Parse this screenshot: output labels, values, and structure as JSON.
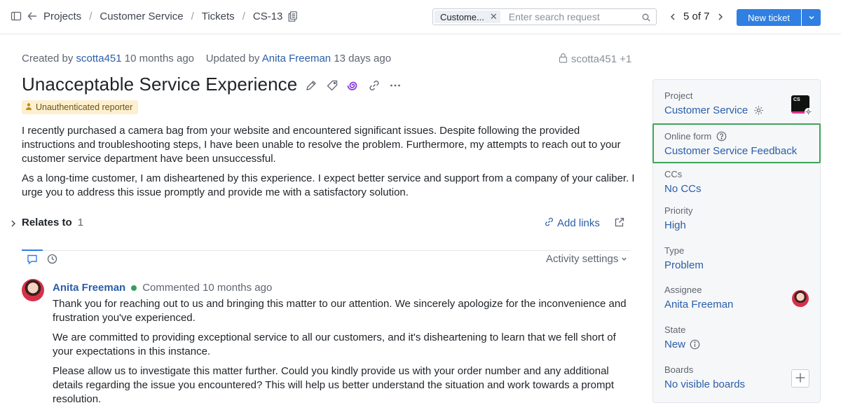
{
  "breadcrumb": [
    "Projects",
    "Customer Service",
    "Tickets",
    "CS-13"
  ],
  "search": {
    "chip": "Custome...",
    "placeholder": "Enter search request"
  },
  "pager": {
    "text": "5 of 7"
  },
  "new_ticket_label": "New ticket",
  "meta": {
    "created_prefix": "Created by",
    "created_by": "scotta451",
    "created_when": "10 months ago",
    "updated_prefix": "Updated by",
    "updated_by": "Anita Freeman",
    "updated_when": "13 days ago",
    "visibility": "scotta451 +1"
  },
  "ticket": {
    "title": "Unacceptable Service Experience",
    "badge": "Unauthenticated reporter",
    "description": [
      "I recently purchased a camera bag from your website and encountered significant issues. Despite following the provided instructions and troubleshooting steps, I have been unable to resolve the problem. Furthermore, my attempts to reach out to your customer service department have been unsuccessful.",
      "As a long-time customer, I am disheartened by this experience. I expect better service and support from a company of your caliber. I urge you to address this issue promptly and provide me with a satisfactory solution."
    ]
  },
  "relates": {
    "label": "Relates to",
    "count": "1",
    "add_links": "Add links"
  },
  "activity": {
    "settings_label": "Activity settings"
  },
  "comment": {
    "author": "Anita Freeman",
    "when": "Commented 10 months ago",
    "paragraphs": [
      "Thank you for reaching out to us and bringing this matter to our attention. We sincerely apologize for the inconvenience and frustration you've experienced.",
      "We are committed to providing exceptional service to all our customers, and it's disheartening to learn that we fell short of your expectations in this instance.",
      "Please allow us to investigate this matter further. Could you kindly provide us with your order number and any additional details regarding the issue you encountered? This will help us better understand the situation and work towards a prompt resolution."
    ]
  },
  "sidebar": {
    "project": {
      "label": "Project",
      "value": "Customer Service",
      "icon_text": "CS"
    },
    "online_form": {
      "label": "Online form",
      "value": "Customer Service Feedback"
    },
    "ccs": {
      "label": "CCs",
      "value": "No CCs"
    },
    "priority": {
      "label": "Priority",
      "value": "High"
    },
    "type": {
      "label": "Type",
      "value": "Problem"
    },
    "assignee": {
      "label": "Assignee",
      "value": "Anita Freeman"
    },
    "state": {
      "label": "State",
      "value": "New"
    },
    "boards": {
      "label": "Boards",
      "value": "No visible boards"
    }
  },
  "colors": {
    "accent": "#307fe2",
    "link": "#2a5ea8",
    "highlight": "#3ea35a",
    "badge_bg": "#fdf0d0"
  }
}
